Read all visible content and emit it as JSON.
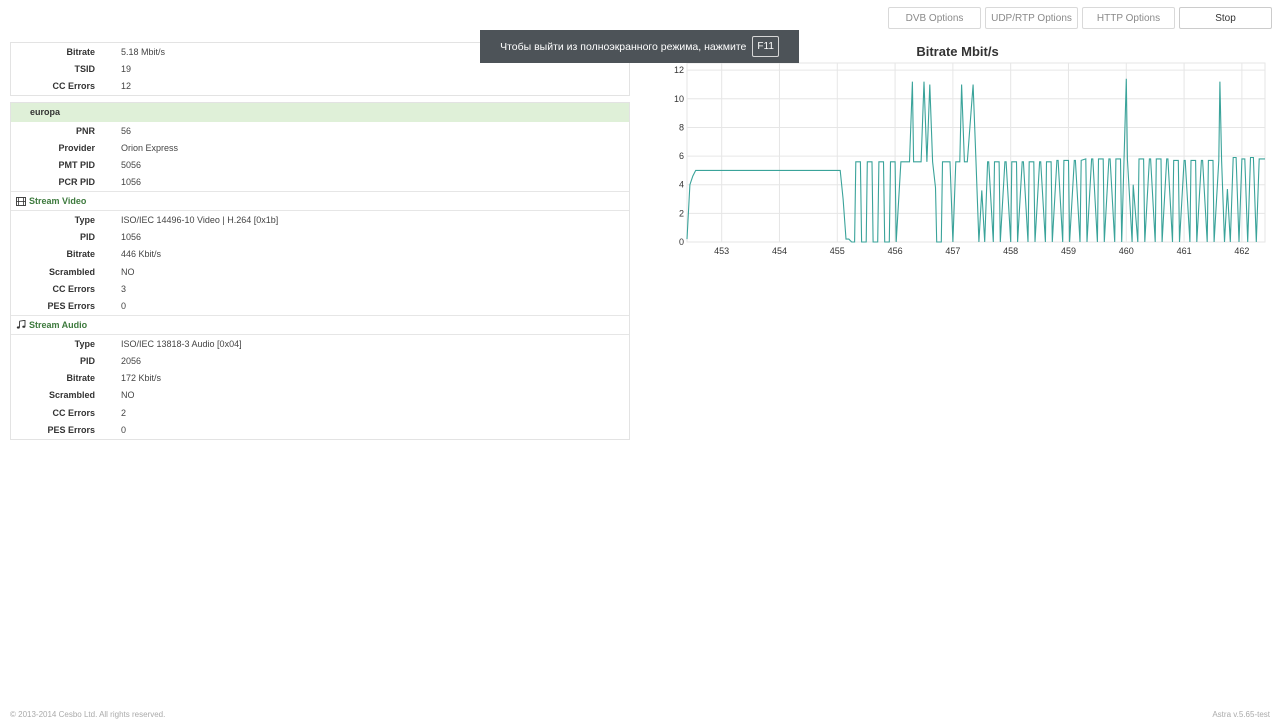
{
  "toolbar": {
    "dvb_options": "DVB Options",
    "udp_rtp_options": "UDP/RTP Options",
    "http_options": "HTTP Options",
    "stop": "Stop"
  },
  "fullscreen_notice": {
    "text": "Чтобы выйти из полноэкранного режима, нажмите",
    "key": "F11"
  },
  "transport": [
    {
      "label": "Bitrate",
      "value": "5.18 Mbit/s"
    },
    {
      "label": "TSID",
      "value": "19"
    },
    {
      "label": "CC Errors",
      "value": "12"
    }
  ],
  "program": {
    "name": "europa",
    "fields": [
      {
        "label": "PNR",
        "value": "56"
      },
      {
        "label": "Provider",
        "value": "Orion Express"
      },
      {
        "label": "PMT PID",
        "value": "5056"
      },
      {
        "label": "PCR PID",
        "value": "1056"
      }
    ]
  },
  "stream_video": {
    "title": "Stream Video",
    "icon": "film-icon",
    "fields": [
      {
        "label": "Type",
        "value": "ISO/IEC 14496-10 Video | H.264 [0x1b]"
      },
      {
        "label": "PID",
        "value": "1056"
      },
      {
        "label": "Bitrate",
        "value": "446 Kbit/s"
      },
      {
        "label": "Scrambled",
        "value": "NO"
      },
      {
        "label": "CC Errors",
        "value": "3"
      },
      {
        "label": "PES Errors",
        "value": "0"
      }
    ]
  },
  "stream_audio": {
    "title": "Stream Audio",
    "icon": "music-icon",
    "fields": [
      {
        "label": "Type",
        "value": "ISO/IEC 13818-3 Audio [0x04]"
      },
      {
        "label": "PID",
        "value": "2056"
      },
      {
        "label": "Bitrate",
        "value": "172 Kbit/s"
      },
      {
        "label": "Scrambled",
        "value": "NO"
      },
      {
        "label": "CC Errors",
        "value": "2"
      },
      {
        "label": "PES Errors",
        "value": "0"
      }
    ]
  },
  "chart_data": {
    "type": "line",
    "title": "Bitrate Mbit/s",
    "xlabel": "",
    "ylabel": "",
    "xlim": [
      452.4,
      462.4
    ],
    "ylim": [
      0,
      12.5
    ],
    "x_ticks": [
      453,
      454,
      455,
      456,
      457,
      458,
      459,
      460,
      461,
      462
    ],
    "y_ticks": [
      0,
      2,
      4,
      6,
      8,
      10,
      12
    ],
    "grid": true,
    "line_color": "#3aa39a",
    "series": [
      {
        "x": [
          452.4,
          452.45,
          452.5,
          452.55,
          453.0,
          454.0,
          455.05,
          455.1,
          455.15,
          455.2,
          455.25,
          455.3,
          455.32,
          455.4,
          455.42,
          455.5,
          455.52,
          455.6,
          455.62,
          455.7,
          455.72,
          455.8,
          455.82,
          455.9,
          455.92,
          456.0,
          456.02,
          456.1,
          456.12,
          456.25,
          456.3,
          456.32,
          456.45,
          456.5,
          456.55,
          456.6,
          456.65,
          456.7,
          456.72,
          456.8,
          456.82,
          456.95,
          457.0,
          457.05,
          457.12,
          457.15,
          457.2,
          457.25,
          457.35,
          457.4,
          457.45,
          457.5,
          457.55,
          457.6,
          457.62,
          457.7,
          457.72,
          457.8,
          457.82,
          457.9,
          457.92,
          458.0,
          458.02,
          458.1,
          458.12,
          458.2,
          458.22,
          458.3,
          458.32,
          458.4,
          458.42,
          458.5,
          458.52,
          458.6,
          458.62,
          458.7,
          458.72,
          458.8,
          458.82,
          458.9,
          458.92,
          459.0,
          459.02,
          459.1,
          459.12,
          459.2,
          459.22,
          459.3,
          459.32,
          459.4,
          459.42,
          459.5,
          459.52,
          459.6,
          459.62,
          459.7,
          459.72,
          459.8,
          459.82,
          459.9,
          459.92,
          460.0,
          460.02,
          460.1,
          460.12,
          460.2,
          460.22,
          460.3,
          460.32,
          460.4,
          460.42,
          460.5,
          460.52,
          460.6,
          460.62,
          460.7,
          460.72,
          460.8,
          460.82,
          460.9,
          460.92,
          461.0,
          461.02,
          461.1,
          461.12,
          461.2,
          461.22,
          461.3,
          461.32,
          461.4,
          461.42,
          461.5,
          461.52,
          461.6,
          461.62,
          461.65,
          461.7,
          461.75,
          461.8,
          461.85,
          461.9,
          461.95,
          462.0,
          462.05,
          462.1,
          462.15,
          462.2,
          462.25,
          462.3,
          462.35,
          462.4
        ],
        "y": [
          0.2,
          4.0,
          4.6,
          5.0,
          5.0,
          5.0,
          5.0,
          3.0,
          0.2,
          0.2,
          0.0,
          0.0,
          5.6,
          5.6,
          0.0,
          0.0,
          5.6,
          5.6,
          0.0,
          0.0,
          5.6,
          5.6,
          0.0,
          0.0,
          5.6,
          5.6,
          0.0,
          5.6,
          5.6,
          5.6,
          11.2,
          5.6,
          5.6,
          11.2,
          5.6,
          11.0,
          5.6,
          3.8,
          0.0,
          0.0,
          5.6,
          5.6,
          0.0,
          5.6,
          5.6,
          11.0,
          5.6,
          5.6,
          11.0,
          5.6,
          0.0,
          3.6,
          0.0,
          5.6,
          5.6,
          0.0,
          5.6,
          5.6,
          0.0,
          5.6,
          5.6,
          0.0,
          5.6,
          5.6,
          0.0,
          5.6,
          5.6,
          0.0,
          5.6,
          5.6,
          0.0,
          5.6,
          5.6,
          0.0,
          5.6,
          5.6,
          0.0,
          5.7,
          5.7,
          0.0,
          5.7,
          5.7,
          0.0,
          5.7,
          5.7,
          0.0,
          5.7,
          5.8,
          0.0,
          5.8,
          5.8,
          0.0,
          5.8,
          5.8,
          0.0,
          5.8,
          5.8,
          0.0,
          5.8,
          5.8,
          0.0,
          11.4,
          5.8,
          0.0,
          4.0,
          0.0,
          5.8,
          5.8,
          0.0,
          5.8,
          5.8,
          0.0,
          5.8,
          5.8,
          0.0,
          5.8,
          5.8,
          0.0,
          5.7,
          5.7,
          0.0,
          5.7,
          5.7,
          0.0,
          5.7,
          5.7,
          0.0,
          5.7,
          5.7,
          0.0,
          5.7,
          5.7,
          0.0,
          5.7,
          11.2,
          5.7,
          0.0,
          3.7,
          0.0,
          5.9,
          5.9,
          0.0,
          5.8,
          5.8,
          0.0,
          5.9,
          5.9,
          0.0,
          5.8,
          5.8,
          5.8
        ]
      }
    ]
  },
  "footer": {
    "copyright": "© 2013-2014 Cesbo Ltd. All rights reserved.",
    "version": "Astra v.5.65-test"
  }
}
